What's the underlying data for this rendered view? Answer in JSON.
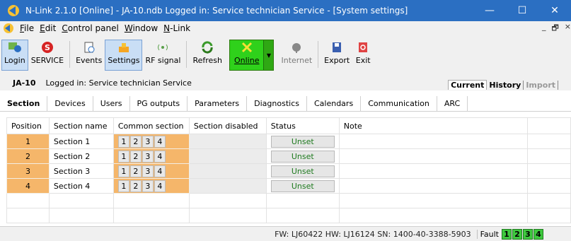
{
  "window": {
    "title": "N-Link 2.1.0 [Online] - JA-10.ndb Logged in: Service technician Service - [System settings]",
    "minimize": "—",
    "maximize": "☐",
    "close": "✕"
  },
  "menu": {
    "items": [
      "File",
      "Edit",
      "Control panel",
      "Window",
      "N-Link"
    ],
    "mdi_min": "_",
    "mdi_restore": "🗗",
    "mdi_close": "×"
  },
  "toolbar": {
    "login": "Login",
    "service": "SERVICE",
    "events": "Events",
    "settings": "Settings",
    "rf_signal": "RF signal",
    "refresh": "Refresh",
    "online": "Online",
    "internet": "Internet",
    "export": "Export",
    "exit": "Exit"
  },
  "info": {
    "device": "JA-10",
    "logged_in": "Logged in: Service technician Service",
    "views": [
      "Current",
      "History",
      "Import"
    ]
  },
  "tabs": [
    "Section",
    "Devices",
    "Users",
    "PG outputs",
    "Parameters",
    "Diagnostics",
    "Calendars",
    "Communication",
    "ARC"
  ],
  "grid": {
    "headers": [
      "Position",
      "Section name",
      "Common section",
      "Section disabled",
      "Status",
      "Note"
    ],
    "rows": [
      {
        "position": "1",
        "name": "Section 1",
        "common": [
          "1",
          "2",
          "3",
          "4"
        ],
        "status": "Unset"
      },
      {
        "position": "2",
        "name": "Section 2",
        "common": [
          "1",
          "2",
          "3",
          "4"
        ],
        "status": "Unset"
      },
      {
        "position": "3",
        "name": "Section 3",
        "common": [
          "1",
          "2",
          "3",
          "4"
        ],
        "status": "Unset"
      },
      {
        "position": "4",
        "name": "Section 4",
        "common": [
          "1",
          "2",
          "3",
          "4"
        ],
        "status": "Unset"
      }
    ]
  },
  "statusbar": {
    "hw": "FW: LJ60422 HW: LJ16124 SN: 1400-40-3388-5903",
    "fault": "Fault",
    "fault_sections": [
      "1",
      "2",
      "3",
      "4"
    ]
  },
  "colors": {
    "titlebar": "#2b6fc2",
    "position_cell": "#f5b66a",
    "online_button": "#2fd11b",
    "status_text": "#1e7a1e",
    "fault_box": "#3ec93e"
  }
}
